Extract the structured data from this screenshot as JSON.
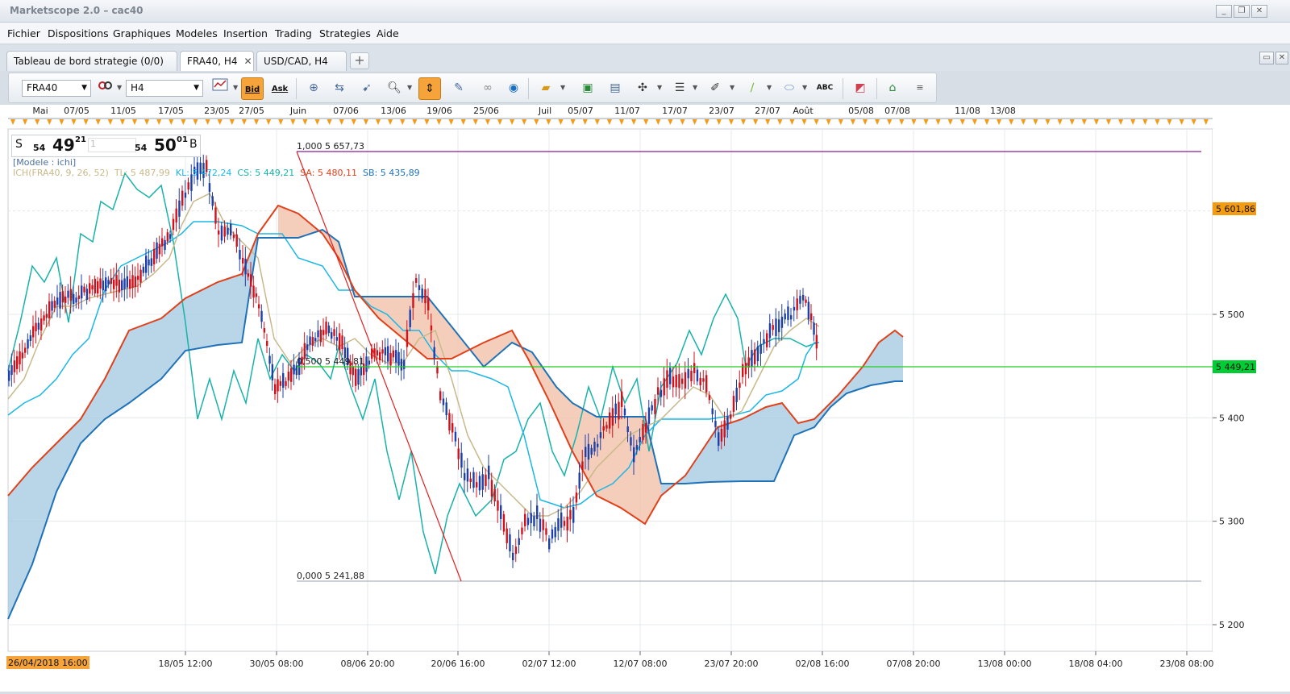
{
  "window": {
    "title": "Marketscope 2.0 – cac40"
  },
  "menu": [
    "Fichier",
    "Dispositions",
    "Graphiques",
    "Modeles",
    "Insertion",
    "Trading",
    "Strategies",
    "Aide"
  ],
  "tabs": [
    {
      "label": "Tableau de bord strategie (0/0)"
    },
    {
      "label": "FRA40, H4",
      "close": "✕"
    },
    {
      "label": "USD/CAD, H4"
    }
  ],
  "tab_add": "+",
  "toolbar": {
    "symbol": "FRA40",
    "timeframe": "H4",
    "bid_label": "Bid",
    "ask_label": "Ask",
    "abc_label": "ABC",
    "icons": [
      "chart-type-icon",
      "bid-icon",
      "ask-icon",
      "crosshair-icon",
      "zoom-icon",
      "cursor-icon",
      "scroll-icon",
      "properties-icon",
      "draw-icon",
      "globe-icon",
      "ruler-icon",
      "image-icon",
      "print-icon",
      "tools-icon",
      "lines-icon",
      "pen-icon",
      "trendline-icon",
      "ellipse-icon",
      "text-icon",
      "eraser-icon",
      "hierarchy-icon",
      "menu-icon"
    ]
  },
  "top_dates": [
    "Mai",
    "07/05",
    "11/05",
    "17/05",
    "23/05",
    "27/05",
    "Juin",
    "07/06",
    "13/06",
    "19/06",
    "25/06",
    "Juil",
    "05/07",
    "11/07",
    "17/07",
    "23/07",
    "27/07",
    "Août",
    "05/08",
    "07/08",
    "11/08",
    "13/08"
  ],
  "quote": {
    "sell_letter": "S",
    "sell_big_prefix": "54",
    "sell_big": "49",
    "sell_sup": "21",
    "amount": "1",
    "buy_big_prefix": "54",
    "buy_big": "50",
    "buy_sup": "01",
    "buy_letter": "B"
  },
  "legend": {
    "model": "[Modele : ichi]",
    "ich": "ICH(FRA40, 9, 26, 52)",
    "tl": "TL: 5 487,99",
    "kl": "KL: 5 472,24",
    "cs": "CS: 5 449,21",
    "sa": "SA: 5 480,11",
    "sb": "SB: 5 435,89"
  },
  "fib_labels": [
    "1,000 5 657,73",
    "0,500 5 449,81",
    "0,000 5 241,88"
  ],
  "price_axis": {
    "ticks": [
      "5 500",
      "5 400",
      "5 300",
      "5 200"
    ],
    "markers": [
      {
        "label": "5 601,86",
        "color": "#f39c12"
      },
      {
        "label": "5 449,21",
        "color": "#00cc33"
      }
    ]
  },
  "time_axis": [
    "26/04/2018 16:00",
    "18/05 12:00",
    "30/05 08:00",
    "08/06 20:00",
    "20/06 16:00",
    "02/07 12:00",
    "12/07 08:00",
    "23/07 20:00",
    "02/08 16:00",
    "07/08 20:00",
    "13/08 00:00",
    "18/08 04:00",
    "23/08 08:00"
  ],
  "colors": {
    "accent": "#f6a33a",
    "bull_candle": "#1c3fa8",
    "bear_candle": "#d0101a",
    "tenkan": "#c8b98a",
    "kijun": "#1ab7e6",
    "chikou": "#19b2a9",
    "span_a": "#e0401a",
    "span_b": "#1f72b8",
    "kumo_bull": "#a8cce3",
    "kumo_bear": "#f2c2aa"
  }
}
